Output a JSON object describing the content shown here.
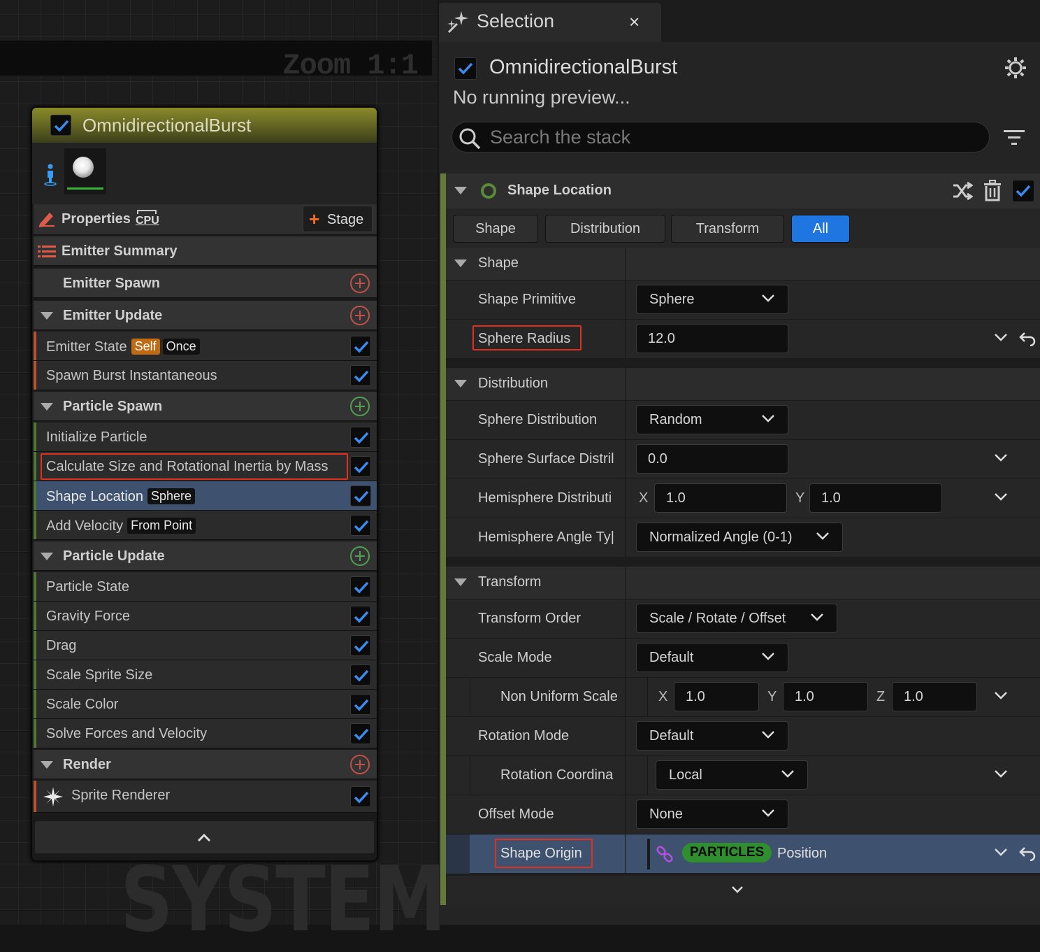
{
  "graph": {
    "zoom_label": "Zoom 1:1",
    "watermark": "SYSTEM"
  },
  "node": {
    "title": "OmnidirectionalBurst",
    "properties_label": "Properties",
    "cpu_badge": "CPU",
    "stage_label": "Stage",
    "emitter_summary": "Emitter Summary",
    "emitter_spawn": "Emitter Spawn",
    "emitter_update": "Emitter Update",
    "emitter_state": "Emitter State",
    "emitter_state_tag1": "Self",
    "emitter_state_tag2": "Once",
    "spawn_burst": "Spawn Burst Instantaneous",
    "particle_spawn": "Particle Spawn",
    "initialize_particle": "Initialize Particle",
    "calc_size": "Calculate Size and Rotational Inertia by Mass",
    "shape_location": "Shape Location",
    "shape_location_tag": "Sphere",
    "add_velocity": "Add Velocity",
    "add_velocity_tag": "From Point",
    "particle_update": "Particle Update",
    "particle_state": "Particle State",
    "gravity_force": "Gravity Force",
    "drag": "Drag",
    "scale_sprite_size": "Scale Sprite Size",
    "scale_color": "Scale Color",
    "solve_forces": "Solve Forces and Velocity",
    "render": "Render",
    "sprite_renderer": "Sprite Renderer"
  },
  "selection": {
    "tab_label": "Selection",
    "close_glyph": "×",
    "title": "OmnidirectionalBurst",
    "status": "No running preview...",
    "search_placeholder": "Search the stack",
    "module_title": "Shape Location",
    "tabs": [
      "Shape",
      "Distribution",
      "Transform",
      "All"
    ],
    "sections": {
      "shape": "Shape",
      "distribution": "Distribution",
      "transform": "Transform"
    },
    "props": {
      "shape_primitive": {
        "name": "Shape Primitive",
        "value": "Sphere"
      },
      "sphere_radius": {
        "name": "Sphere Radius",
        "value": "12.0"
      },
      "sphere_distribution": {
        "name": "Sphere Distribution",
        "value": "Random"
      },
      "sphere_surface": {
        "name": "Sphere Surface Distril",
        "value": "0.0"
      },
      "hemisphere_distribution": {
        "name": "Hemisphere Distributi",
        "x_label": "X",
        "x": "1.0",
        "y_label": "Y",
        "y": "1.0"
      },
      "hemisphere_angle": {
        "name": "Hemisphere Angle Ty|",
        "value": "Normalized Angle (0-1)"
      },
      "transform_order": {
        "name": "Transform Order",
        "value": "Scale / Rotate / Offset"
      },
      "scale_mode": {
        "name": "Scale Mode",
        "value": "Default"
      },
      "non_uniform_scale": {
        "name": "Non Uniform Scalе",
        "x_label": "X",
        "x": "1.0",
        "y_label": "Y",
        "y": "1.0",
        "z_label": "Z",
        "z": "1.0"
      },
      "rotation_mode": {
        "name": "Rotation Mode",
        "value": "Default"
      },
      "rotation_coord": {
        "name": "Rotation Coordina",
        "value": "Local"
      },
      "offset_mode": {
        "name": "Offset Mode",
        "value": "None"
      },
      "shape_origin": {
        "name": "Shape Origin",
        "namespace": "PARTICLES",
        "value": "Position"
      }
    }
  },
  "colors": {
    "accent_blue": "#1f76e0",
    "highlight_red": "#e0301e",
    "particles_green": "#2f8f2f",
    "stack_edge": "#637a3a"
  }
}
